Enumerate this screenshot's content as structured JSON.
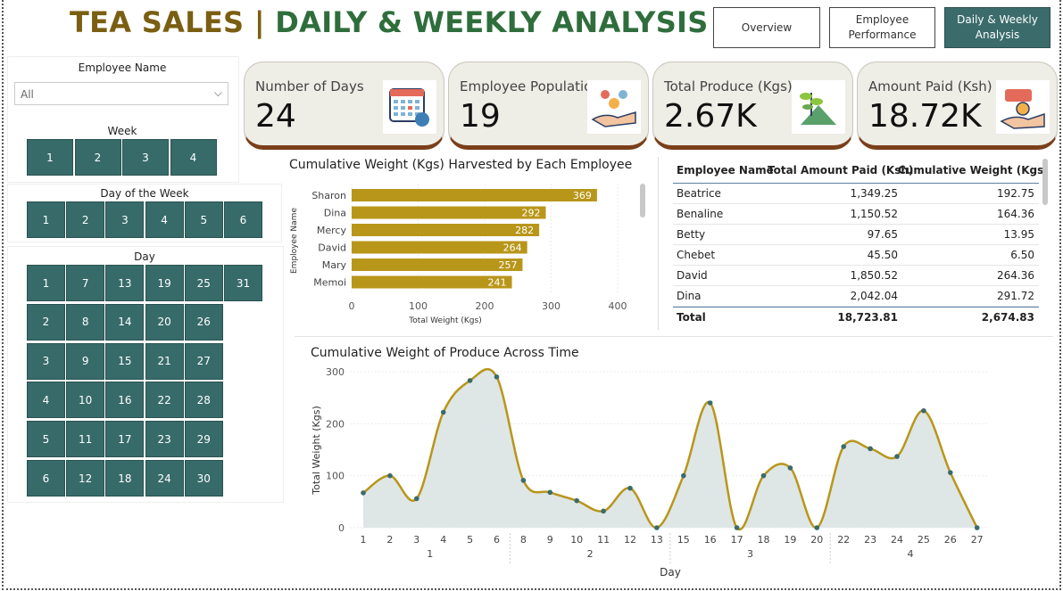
{
  "title": {
    "part1": "TEA SALES | ",
    "part2": "DAILY & WEEKLY ANALYSIS"
  },
  "nav": {
    "overview": "Overview",
    "employee_performance_l1": "Employee",
    "employee_performance_l2": "Performance",
    "daily_weekly_l1": "Daily & Weekly",
    "daily_weekly_l2": "Analysis"
  },
  "filters": {
    "employee_label": "Employee Name",
    "employee_value": "All",
    "week_label": "Week",
    "weeks": [
      "1",
      "2",
      "3",
      "4"
    ],
    "dow_label": "Day of the Week",
    "dows": [
      "1",
      "2",
      "3",
      "4",
      "5",
      "6"
    ],
    "day_label": "Day",
    "day_rows": [
      [
        "1",
        "7",
        "13",
        "19",
        "25",
        "31"
      ],
      [
        "2",
        "8",
        "14",
        "20",
        "26"
      ],
      [
        "3",
        "9",
        "15",
        "21",
        "27"
      ],
      [
        "4",
        "10",
        "16",
        "22",
        "28"
      ],
      [
        "5",
        "11",
        "17",
        "23",
        "29"
      ],
      [
        "6",
        "12",
        "18",
        "24",
        "30"
      ]
    ]
  },
  "kpis": [
    {
      "label": "Number of Days",
      "value": "24",
      "icon": "calendar-icon"
    },
    {
      "label": "Employee Population",
      "value": "19",
      "icon": "people-icon"
    },
    {
      "label": "Total Produce (Kgs)",
      "value": "2.67K",
      "icon": "plant-icon"
    },
    {
      "label": "Amount Paid (Ksh)",
      "value": "18.72K",
      "icon": "money-hand-icon"
    }
  ],
  "table": {
    "headers": [
      "Employee Name",
      "Total Amount Paid (Ksh)",
      "Cumulative Weight (Kgs)"
    ],
    "rows": [
      [
        "Beatrice",
        "1,349.25",
        "192.75"
      ],
      [
        "Benaline",
        "1,150.52",
        "164.36"
      ],
      [
        "Betty",
        "97.65",
        "13.95"
      ],
      [
        "Chebet",
        "45.50",
        "6.50"
      ],
      [
        "David",
        "1,850.52",
        "264.36"
      ],
      [
        "Dina",
        "2,042.04",
        "291.72"
      ]
    ],
    "total": [
      "Total",
      "18,723.81",
      "2,674.83"
    ]
  },
  "chart_data": [
    {
      "type": "bar",
      "title": "Cumulative Weight (Kgs) Harvested by Each Employee",
      "xlabel": "Total Weight (Kgs)",
      "ylabel": "Employee Name",
      "categories": [
        "Sharon",
        "Dina",
        "Mercy",
        "David",
        "Mary",
        "Memoi"
      ],
      "values": [
        369,
        292,
        282,
        264,
        257,
        241
      ],
      "xlim": [
        0,
        400
      ],
      "xticks": [
        "0",
        "100",
        "200",
        "300",
        "400"
      ],
      "bar_color": "#b8961a"
    },
    {
      "type": "area",
      "title": "Cumulative Weight of Produce Across Time",
      "xlabel": "Day",
      "ylabel": "Total Weight (Kgs)",
      "x": [
        "1",
        "2",
        "3",
        "4",
        "5",
        "6",
        "8",
        "9",
        "10",
        "11",
        "12",
        "13",
        "15",
        "16",
        "17",
        "18",
        "19",
        "20",
        "22",
        "23",
        "24",
        "25",
        "26",
        "27"
      ],
      "values": [
        67,
        100,
        56,
        222,
        283,
        290,
        91,
        68,
        52,
        32,
        76,
        0,
        100,
        240,
        0,
        100,
        115,
        0,
        156,
        152,
        137,
        225,
        106,
        0
      ],
      "week_groups": [
        {
          "label": "1",
          "count": 6
        },
        {
          "label": "2",
          "count": 6
        },
        {
          "label": "3",
          "count": 6
        },
        {
          "label": "4",
          "count": 6
        }
      ],
      "ylim": [
        0,
        300
      ],
      "yticks": [
        "0",
        "100",
        "200",
        "300"
      ],
      "line_color": "#b8961a",
      "fill_color": "#dfe6e6",
      "point_color": "#3b6b6b"
    }
  ]
}
